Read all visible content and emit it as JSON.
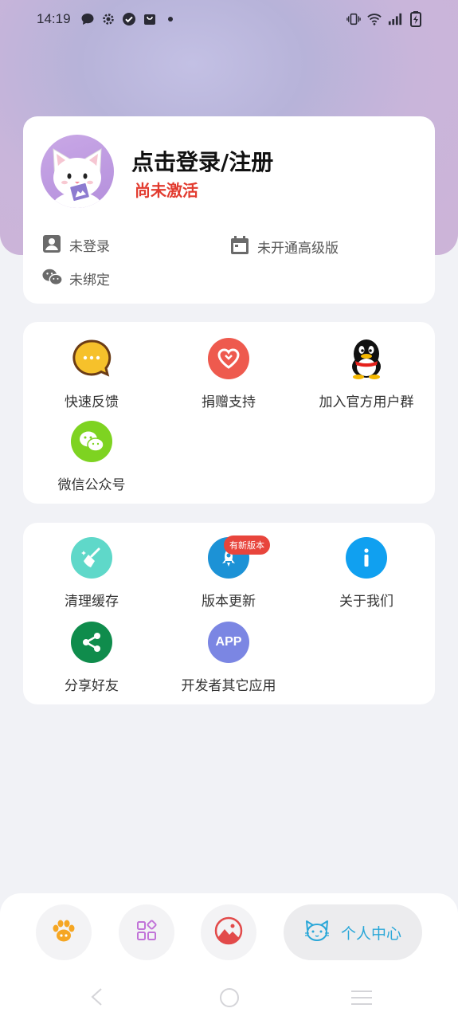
{
  "status_bar": {
    "time": "14:19"
  },
  "profile": {
    "title": "点击登录/注册",
    "activation_status": "尚未激活",
    "login_status": "未登录",
    "premium_status": "未开通高级版",
    "wechat_status": "未绑定"
  },
  "support_grid": [
    {
      "label": "快速反馈",
      "icon": "chat-bubble-icon",
      "color": "#f6c12b"
    },
    {
      "label": "捐赠支持",
      "icon": "heart-icon",
      "color": "#ee5a4e"
    },
    {
      "label": "加入官方用户群",
      "icon": "qq-penguin-icon",
      "color": "#111111"
    },
    {
      "label": "微信公众号",
      "icon": "wechat-icon",
      "color": "#7ed321"
    }
  ],
  "tools_grid": [
    {
      "label": "清理缓存",
      "icon": "broom-icon",
      "color": "#5fd8c9"
    },
    {
      "label": "版本更新",
      "icon": "rocket-icon",
      "color": "#1c92d6",
      "badge": "有新版本"
    },
    {
      "label": "关于我们",
      "icon": "info-icon",
      "color": "#10a0f0"
    },
    {
      "label": "分享好友",
      "icon": "share-icon",
      "color": "#0f8c4c"
    },
    {
      "label": "开发者其它应用",
      "icon": "app-icon",
      "color": "#7b86e3",
      "icon_text": "APP"
    }
  ],
  "bottom_nav": {
    "active_label": "个人中心",
    "items": [
      "paw-icon",
      "grid-icon",
      "image-icon",
      "cat-icon"
    ]
  }
}
